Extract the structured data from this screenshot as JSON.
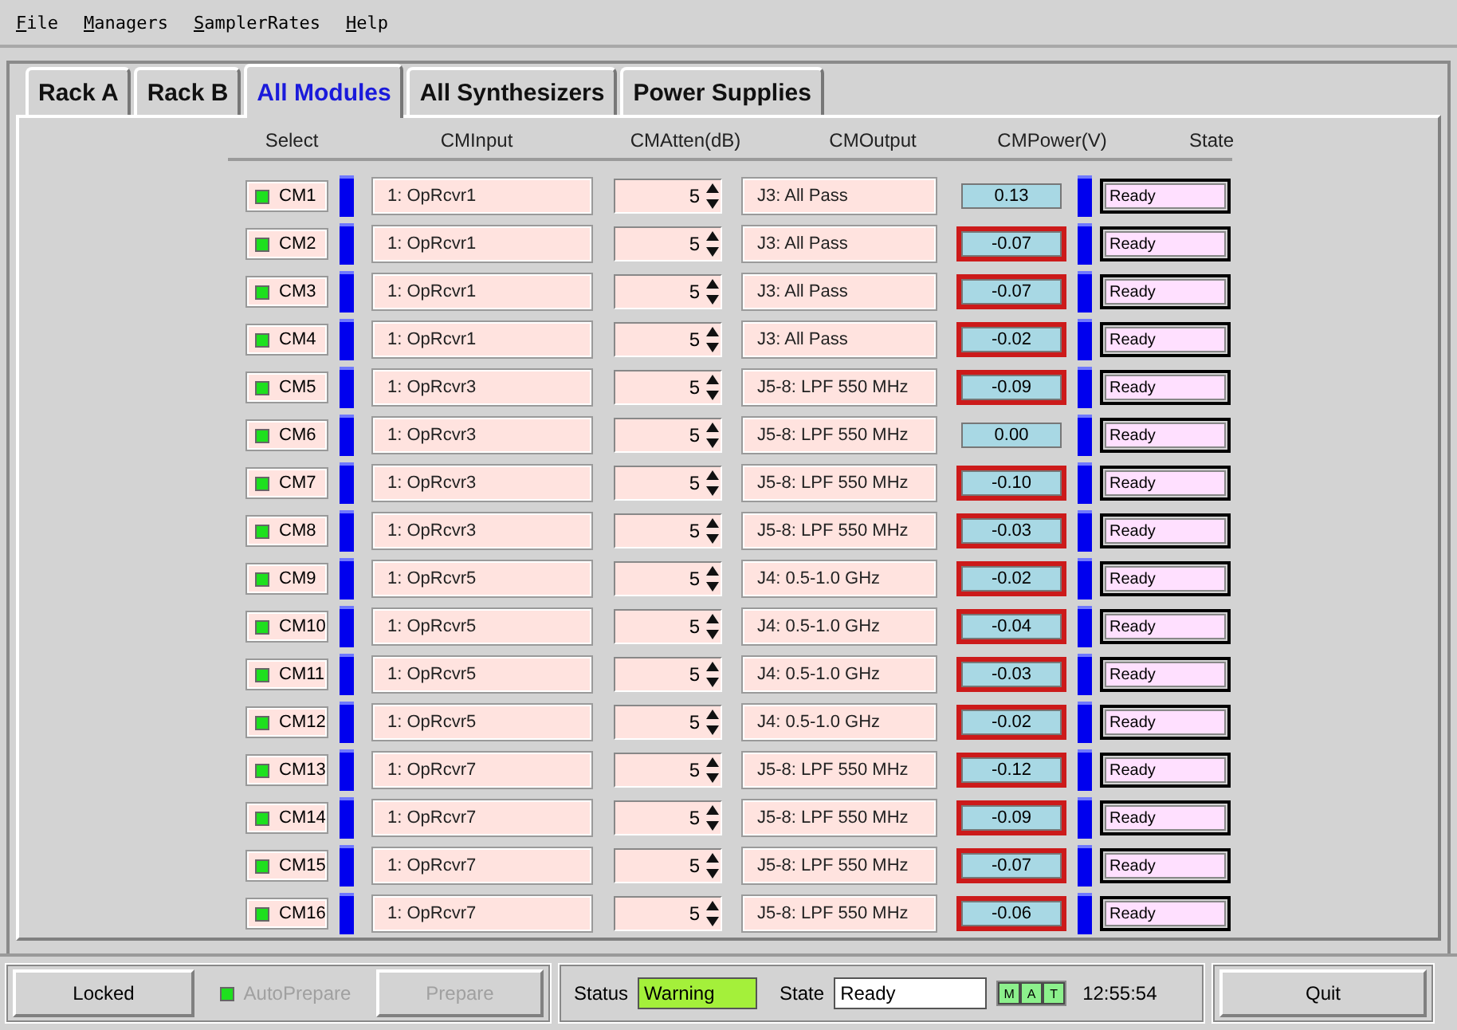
{
  "menu": [
    "File",
    "Managers",
    "SamplerRates",
    "Help"
  ],
  "tabs": [
    {
      "label": "Rack A",
      "selected": false
    },
    {
      "label": "Rack B",
      "selected": false
    },
    {
      "label": "All Modules",
      "selected": true
    },
    {
      "label": "All Synthesizers",
      "selected": false
    },
    {
      "label": "Power Supplies",
      "selected": false
    }
  ],
  "table": {
    "columns": [
      "Select",
      "CMInput",
      "CMAtten(dB)",
      "CMOutput",
      "CMPower(V)",
      "State"
    ],
    "rows": [
      {
        "module": "CM1",
        "checked": true,
        "input": "1: OpRcvr1",
        "atten": "5",
        "output": "J3: All Pass",
        "power": "0.13",
        "alarm": false,
        "state": "Ready"
      },
      {
        "module": "CM2",
        "checked": true,
        "input": "1: OpRcvr1",
        "atten": "5",
        "output": "J3: All Pass",
        "power": "-0.07",
        "alarm": true,
        "state": "Ready"
      },
      {
        "module": "CM3",
        "checked": true,
        "input": "1: OpRcvr1",
        "atten": "5",
        "output": "J3: All Pass",
        "power": "-0.07",
        "alarm": true,
        "state": "Ready"
      },
      {
        "module": "CM4",
        "checked": true,
        "input": "1: OpRcvr1",
        "atten": "5",
        "output": "J3: All Pass",
        "power": "-0.02",
        "alarm": true,
        "state": "Ready"
      },
      {
        "module": "CM5",
        "checked": true,
        "input": "1: OpRcvr3",
        "atten": "5",
        "output": "J5-8: LPF 550 MHz",
        "power": "-0.09",
        "alarm": true,
        "state": "Ready"
      },
      {
        "module": "CM6",
        "checked": true,
        "input": "1: OpRcvr3",
        "atten": "5",
        "output": "J5-8: LPF 550 MHz",
        "power": "0.00",
        "alarm": false,
        "state": "Ready"
      },
      {
        "module": "CM7",
        "checked": true,
        "input": "1: OpRcvr3",
        "atten": "5",
        "output": "J5-8: LPF 550 MHz",
        "power": "-0.10",
        "alarm": true,
        "state": "Ready"
      },
      {
        "module": "CM8",
        "checked": true,
        "input": "1: OpRcvr3",
        "atten": "5",
        "output": "J5-8: LPF 550 MHz",
        "power": "-0.03",
        "alarm": true,
        "state": "Ready"
      },
      {
        "module": "CM9",
        "checked": true,
        "input": "1: OpRcvr5",
        "atten": "5",
        "output": "J4: 0.5-1.0 GHz",
        "power": "-0.02",
        "alarm": true,
        "state": "Ready"
      },
      {
        "module": "CM10",
        "checked": true,
        "input": "1: OpRcvr5",
        "atten": "5",
        "output": "J4: 0.5-1.0 GHz",
        "power": "-0.04",
        "alarm": true,
        "state": "Ready"
      },
      {
        "module": "CM11",
        "checked": true,
        "input": "1: OpRcvr5",
        "atten": "5",
        "output": "J4: 0.5-1.0 GHz",
        "power": "-0.03",
        "alarm": true,
        "state": "Ready"
      },
      {
        "module": "CM12",
        "checked": true,
        "input": "1: OpRcvr5",
        "atten": "5",
        "output": "J4: 0.5-1.0 GHz",
        "power": "-0.02",
        "alarm": true,
        "state": "Ready"
      },
      {
        "module": "CM13",
        "checked": true,
        "input": "1: OpRcvr7",
        "atten": "5",
        "output": "J5-8: LPF 550 MHz",
        "power": "-0.12",
        "alarm": true,
        "state": "Ready"
      },
      {
        "module": "CM14",
        "checked": true,
        "input": "1: OpRcvr7",
        "atten": "5",
        "output": "J5-8: LPF 550 MHz",
        "power": "-0.09",
        "alarm": true,
        "state": "Ready"
      },
      {
        "module": "CM15",
        "checked": true,
        "input": "1: OpRcvr7",
        "atten": "5",
        "output": "J5-8: LPF 550 MHz",
        "power": "-0.07",
        "alarm": true,
        "state": "Ready"
      },
      {
        "module": "CM16",
        "checked": true,
        "input": "1: OpRcvr7",
        "atten": "5",
        "output": "J5-8: LPF 550 MHz",
        "power": "-0.06",
        "alarm": true,
        "state": "Ready"
      }
    ]
  },
  "footer": {
    "lock_button": "Locked",
    "auto_prepare": {
      "label": "AutoPrepare",
      "checked": true,
      "disabled": true
    },
    "prepare_button": {
      "label": "Prepare",
      "disabled": true
    },
    "status_label": "Status",
    "status_value": "Warning",
    "state_label": "State",
    "state_value": "Ready",
    "indicators": [
      {
        "label": "M",
        "on": true
      },
      {
        "label": "A",
        "on": true
      },
      {
        "label": "T",
        "on": true
      }
    ],
    "time": "12:55:54",
    "quit_button": "Quit"
  }
}
